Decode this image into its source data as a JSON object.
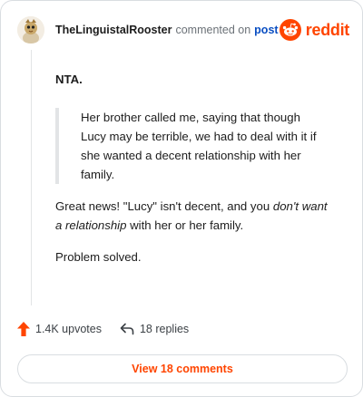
{
  "header": {
    "username": "TheLinguistalRooster",
    "action_text": "commented on",
    "post_link": "post",
    "brand_word": "reddit",
    "brand_color": "#ff4500",
    "avatar_icon": "snoo-avatar-icon"
  },
  "comment": {
    "verdict": "NTA.",
    "quote": "Her brother called me, saying that though Lucy may be terrible, we had to deal with it if she wanted a decent relationship with her family.",
    "para1_a": "Great news! \"Lucy\" isn't decent, and you ",
    "para1_em": "don't want a relationship",
    "para1_b": " with her or her family.",
    "para2": "Problem solved."
  },
  "footer": {
    "upvotes": "1.4K upvotes",
    "replies": "18 replies",
    "upvote_icon": "upvote-arrow-icon",
    "reply_icon": "reply-icon",
    "upvote_color": "#ff4500"
  },
  "view_button": "View 18 comments"
}
